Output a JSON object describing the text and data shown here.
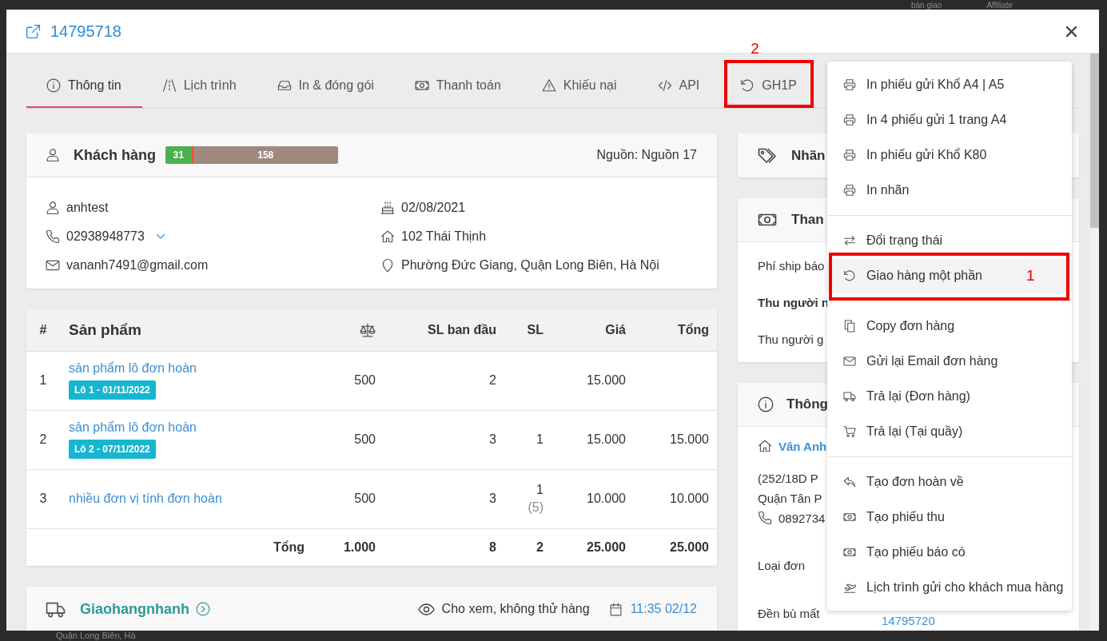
{
  "background_page": {
    "top_cells": [
      "bàn giao",
      "Affiliate"
    ],
    "bottom_cell": "Quận Long Biên, Hà"
  },
  "modal": {
    "title": "14795718"
  },
  "tabs": [
    {
      "label": "Thông tin",
      "selected": true
    },
    {
      "label": "Lịch trình",
      "selected": false
    },
    {
      "label": "In & đóng gói",
      "selected": false
    },
    {
      "label": "Thanh toán",
      "selected": false
    },
    {
      "label": "Khiếu nại",
      "selected": false
    },
    {
      "label": "API",
      "selected": false
    },
    {
      "label": "GH1P",
      "selected": false,
      "callout": "2"
    }
  ],
  "customer": {
    "title": "Khách hàng",
    "stats": {
      "level": 0.16,
      "first_count": "31",
      "second_count": "158"
    },
    "source": "Nguồn: Nguồn 17",
    "username": "anhtest",
    "phone": "02938948773",
    "email": "vananh7491@gmail.com",
    "birthday": "02/08/2021",
    "address": "102 Thái Thịnh",
    "area": "Phường Đức Giang, Quận Long Biên, Hà Nội"
  },
  "products": {
    "columns": [
      {
        "kind": "text",
        "label": "#"
      },
      {
        "kind": "title",
        "label": "Sản phẩm"
      },
      {
        "kind": "icon"
      },
      {
        "kind": "text",
        "label": "SL ban đầu"
      },
      {
        "kind": "text",
        "label": "SL"
      },
      {
        "kind": "text",
        "label": "Giá"
      },
      {
        "kind": "text",
        "label": "Tổng"
      }
    ],
    "rows": [
      {
        "index": "1",
        "name": "sản phẩm lô đơn hoàn",
        "batch": "Lô 1 - 01/11/2022",
        "weight": "500",
        "initial_qty": "2",
        "price": "15.000"
      },
      {
        "index": "2",
        "name": "sản phẩm lô đơn hoàn",
        "batch": "Lô 2 - 07/11/2022",
        "weight": "500",
        "initial_qty": "3",
        "qty": "1",
        "price": "15.000",
        "total": "15.000"
      },
      {
        "index": "3",
        "name": "nhiều đơn vị tính đơn hoàn",
        "weight": "500",
        "initial_qty": "3",
        "qty": "1",
        "qty_note": "(5)",
        "price": "10.000",
        "total": "10.000"
      }
    ],
    "footer": {
      "label": "Tổng",
      "weight": "1.000",
      "initial_qty": "8",
      "qty": "2",
      "price": "25.000",
      "total": "25.000"
    }
  },
  "shipping": {
    "carrier": "Giaohangnhanh",
    "view_option": "Cho xem, không thử hàng",
    "time": "11:35 02/12"
  },
  "tags_card": {
    "title": "Nhãn"
  },
  "payment_card": {
    "title": "Than",
    "rows": [
      {
        "label": "Phí ship báo",
        "strong": false
      },
      {
        "label": "Thu người n",
        "strong": true
      },
      {
        "label": "Thu người g",
        "strong": false
      }
    ]
  },
  "info_card": {
    "title": "Thông",
    "recipient": "Vân Anh",
    "address_lines": [
      "(252/18D P",
      "Quận Tân P"
    ],
    "phone": "0892734",
    "fields": [
      {
        "label": "Loại đơn"
      },
      {
        "label": "Đền bù mất",
        "value": "14795720"
      }
    ]
  },
  "action_menu": {
    "groups": [
      {
        "items": [
          {
            "label": "In phiếu gửi Khổ A4 | A5",
            "highlighted": false
          },
          {
            "label": "In 4 phiếu gửi 1 trang A4",
            "highlighted": false
          },
          {
            "label": "In phiếu gửi Khổ K80",
            "highlighted": false
          },
          {
            "label": "In nhãn",
            "highlighted": false
          }
        ]
      },
      {
        "items": [
          {
            "label": "Đổi trạng thái",
            "highlighted": false
          },
          {
            "label": "Giao hàng một phần",
            "highlighted": true,
            "callout": "1"
          }
        ]
      },
      {
        "items": [
          {
            "label": "Copy đơn hàng",
            "highlighted": false
          },
          {
            "label": "Gửi lại Email đơn hàng",
            "highlighted": false
          },
          {
            "label": "Trả lại (Đơn hàng)",
            "highlighted": false
          },
          {
            "label": "Trả lại (Tại quầy)",
            "highlighted": false
          }
        ]
      },
      {
        "items": [
          {
            "label": "Tạo đơn hoàn về",
            "highlighted": false
          },
          {
            "label": "Tạo phiếu thu",
            "highlighted": false
          },
          {
            "label": "Tạo phiếu báo có",
            "highlighted": false
          },
          {
            "label": "Lịch trình gửi cho khách mua hàng",
            "highlighted": false
          }
        ]
      }
    ]
  }
}
